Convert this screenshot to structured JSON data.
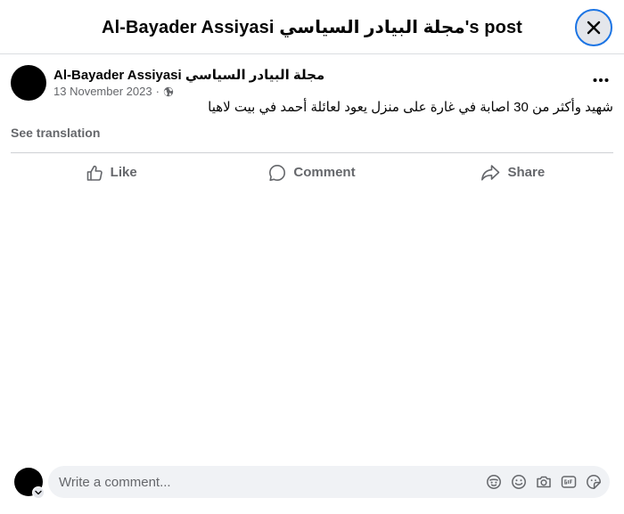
{
  "header": {
    "title": "Al-Bayader Assiyasi مجلة البيادر السياسي's post",
    "close_icon": "close-icon"
  },
  "post": {
    "author": "Al-Bayader Assiyasi مجلة البيادر السياسي",
    "date": "13 November 2023",
    "separator": "·",
    "audience_icon": "globe-icon",
    "more_icon": "more-horizontal-icon",
    "text": "شهيد وأكثر من 30 اصابة في غارة على منزل يعود لعائلة أحمد في بيت لاهيا",
    "see_translation": "See translation"
  },
  "actions": [
    {
      "label": "Like",
      "icon": "thumbs-up-icon"
    },
    {
      "label": "Comment",
      "icon": "comment-bubble-icon"
    },
    {
      "label": "Share",
      "icon": "share-arrow-icon"
    }
  ],
  "comment": {
    "placeholder": "Write a comment...",
    "icons": [
      "avatar-sticker-icon",
      "emoji-icon",
      "camera-icon",
      "gif-icon",
      "sticker-icon"
    ]
  },
  "colors": {
    "accent": "#1b74e4",
    "secondary_text": "#65676b",
    "input_background": "#f0f2f5",
    "button_background": "#e4e6eb"
  }
}
